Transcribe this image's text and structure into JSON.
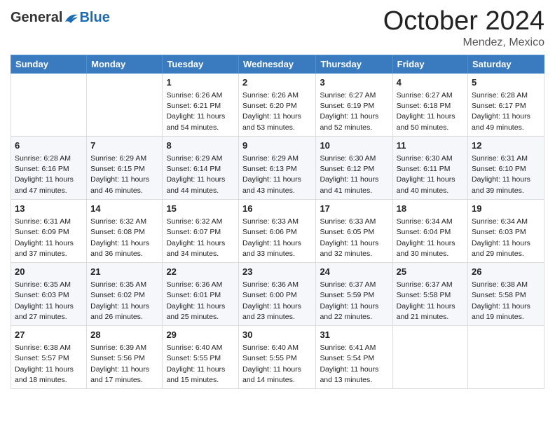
{
  "logo": {
    "general": "General",
    "blue": "Blue"
  },
  "title": "October 2024",
  "location": "Mendez, Mexico",
  "weekdays": [
    "Sunday",
    "Monday",
    "Tuesday",
    "Wednesday",
    "Thursday",
    "Friday",
    "Saturday"
  ],
  "weeks": [
    [
      null,
      null,
      {
        "day": "1",
        "sunrise": "Sunrise: 6:26 AM",
        "sunset": "Sunset: 6:21 PM",
        "daylight": "Daylight: 11 hours and 54 minutes."
      },
      {
        "day": "2",
        "sunrise": "Sunrise: 6:26 AM",
        "sunset": "Sunset: 6:20 PM",
        "daylight": "Daylight: 11 hours and 53 minutes."
      },
      {
        "day": "3",
        "sunrise": "Sunrise: 6:27 AM",
        "sunset": "Sunset: 6:19 PM",
        "daylight": "Daylight: 11 hours and 52 minutes."
      },
      {
        "day": "4",
        "sunrise": "Sunrise: 6:27 AM",
        "sunset": "Sunset: 6:18 PM",
        "daylight": "Daylight: 11 hours and 50 minutes."
      },
      {
        "day": "5",
        "sunrise": "Sunrise: 6:28 AM",
        "sunset": "Sunset: 6:17 PM",
        "daylight": "Daylight: 11 hours and 49 minutes."
      }
    ],
    [
      {
        "day": "6",
        "sunrise": "Sunrise: 6:28 AM",
        "sunset": "Sunset: 6:16 PM",
        "daylight": "Daylight: 11 hours and 47 minutes."
      },
      {
        "day": "7",
        "sunrise": "Sunrise: 6:29 AM",
        "sunset": "Sunset: 6:15 PM",
        "daylight": "Daylight: 11 hours and 46 minutes."
      },
      {
        "day": "8",
        "sunrise": "Sunrise: 6:29 AM",
        "sunset": "Sunset: 6:14 PM",
        "daylight": "Daylight: 11 hours and 44 minutes."
      },
      {
        "day": "9",
        "sunrise": "Sunrise: 6:29 AM",
        "sunset": "Sunset: 6:13 PM",
        "daylight": "Daylight: 11 hours and 43 minutes."
      },
      {
        "day": "10",
        "sunrise": "Sunrise: 6:30 AM",
        "sunset": "Sunset: 6:12 PM",
        "daylight": "Daylight: 11 hours and 41 minutes."
      },
      {
        "day": "11",
        "sunrise": "Sunrise: 6:30 AM",
        "sunset": "Sunset: 6:11 PM",
        "daylight": "Daylight: 11 hours and 40 minutes."
      },
      {
        "day": "12",
        "sunrise": "Sunrise: 6:31 AM",
        "sunset": "Sunset: 6:10 PM",
        "daylight": "Daylight: 11 hours and 39 minutes."
      }
    ],
    [
      {
        "day": "13",
        "sunrise": "Sunrise: 6:31 AM",
        "sunset": "Sunset: 6:09 PM",
        "daylight": "Daylight: 11 hours and 37 minutes."
      },
      {
        "day": "14",
        "sunrise": "Sunrise: 6:32 AM",
        "sunset": "Sunset: 6:08 PM",
        "daylight": "Daylight: 11 hours and 36 minutes."
      },
      {
        "day": "15",
        "sunrise": "Sunrise: 6:32 AM",
        "sunset": "Sunset: 6:07 PM",
        "daylight": "Daylight: 11 hours and 34 minutes."
      },
      {
        "day": "16",
        "sunrise": "Sunrise: 6:33 AM",
        "sunset": "Sunset: 6:06 PM",
        "daylight": "Daylight: 11 hours and 33 minutes."
      },
      {
        "day": "17",
        "sunrise": "Sunrise: 6:33 AM",
        "sunset": "Sunset: 6:05 PM",
        "daylight": "Daylight: 11 hours and 32 minutes."
      },
      {
        "day": "18",
        "sunrise": "Sunrise: 6:34 AM",
        "sunset": "Sunset: 6:04 PM",
        "daylight": "Daylight: 11 hours and 30 minutes."
      },
      {
        "day": "19",
        "sunrise": "Sunrise: 6:34 AM",
        "sunset": "Sunset: 6:03 PM",
        "daylight": "Daylight: 11 hours and 29 minutes."
      }
    ],
    [
      {
        "day": "20",
        "sunrise": "Sunrise: 6:35 AM",
        "sunset": "Sunset: 6:03 PM",
        "daylight": "Daylight: 11 hours and 27 minutes."
      },
      {
        "day": "21",
        "sunrise": "Sunrise: 6:35 AM",
        "sunset": "Sunset: 6:02 PM",
        "daylight": "Daylight: 11 hours and 26 minutes."
      },
      {
        "day": "22",
        "sunrise": "Sunrise: 6:36 AM",
        "sunset": "Sunset: 6:01 PM",
        "daylight": "Daylight: 11 hours and 25 minutes."
      },
      {
        "day": "23",
        "sunrise": "Sunrise: 6:36 AM",
        "sunset": "Sunset: 6:00 PM",
        "daylight": "Daylight: 11 hours and 23 minutes."
      },
      {
        "day": "24",
        "sunrise": "Sunrise: 6:37 AM",
        "sunset": "Sunset: 5:59 PM",
        "daylight": "Daylight: 11 hours and 22 minutes."
      },
      {
        "day": "25",
        "sunrise": "Sunrise: 6:37 AM",
        "sunset": "Sunset: 5:58 PM",
        "daylight": "Daylight: 11 hours and 21 minutes."
      },
      {
        "day": "26",
        "sunrise": "Sunrise: 6:38 AM",
        "sunset": "Sunset: 5:58 PM",
        "daylight": "Daylight: 11 hours and 19 minutes."
      }
    ],
    [
      {
        "day": "27",
        "sunrise": "Sunrise: 6:38 AM",
        "sunset": "Sunset: 5:57 PM",
        "daylight": "Daylight: 11 hours and 18 minutes."
      },
      {
        "day": "28",
        "sunrise": "Sunrise: 6:39 AM",
        "sunset": "Sunset: 5:56 PM",
        "daylight": "Daylight: 11 hours and 17 minutes."
      },
      {
        "day": "29",
        "sunrise": "Sunrise: 6:40 AM",
        "sunset": "Sunset: 5:55 PM",
        "daylight": "Daylight: 11 hours and 15 minutes."
      },
      {
        "day": "30",
        "sunrise": "Sunrise: 6:40 AM",
        "sunset": "Sunset: 5:55 PM",
        "daylight": "Daylight: 11 hours and 14 minutes."
      },
      {
        "day": "31",
        "sunrise": "Sunrise: 6:41 AM",
        "sunset": "Sunset: 5:54 PM",
        "daylight": "Daylight: 11 hours and 13 minutes."
      },
      null,
      null
    ]
  ]
}
